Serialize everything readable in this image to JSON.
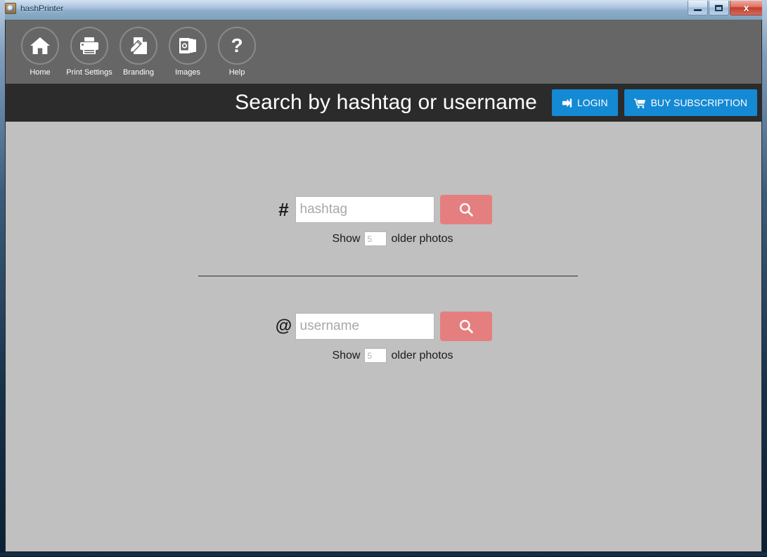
{
  "window": {
    "title": "hashPrinter",
    "app_icon": "app-icon",
    "controls": {
      "minimize": "minimize-button",
      "maximize": "maximize-button",
      "close_label": "x"
    }
  },
  "toolbar": {
    "items": [
      {
        "label": "Home",
        "icon": "home-icon"
      },
      {
        "label": "Print Settings",
        "icon": "printer-icon"
      },
      {
        "label": "Branding",
        "icon": "document-pencil-icon"
      },
      {
        "label": "Images",
        "icon": "photo-stack-icon"
      },
      {
        "label": "Help",
        "icon": "question-mark-icon"
      }
    ]
  },
  "header": {
    "title": "Search by hashtag or username",
    "login_label": "LOGIN",
    "login_icon": "sign-in-icon",
    "buy_label": "BUY SUBSCRIPTION",
    "buy_icon": "shopping-cart-icon",
    "button_color": "#1489d4",
    "background": "#2b2b2b"
  },
  "search": {
    "hashtag": {
      "sigil": "#",
      "placeholder": "hashtag",
      "value": "",
      "button_icon": "search-icon",
      "show_prefix": "Show",
      "count_placeholder": "5",
      "count_value": "",
      "show_suffix": "older photos"
    },
    "username": {
      "sigil": "@",
      "placeholder": "username",
      "value": "",
      "button_icon": "search-icon",
      "show_prefix": "Show",
      "count_placeholder": "5",
      "count_value": "",
      "show_suffix": "older photos"
    },
    "button_color": "#e57f7f",
    "body_background": "#c0c0c0"
  }
}
